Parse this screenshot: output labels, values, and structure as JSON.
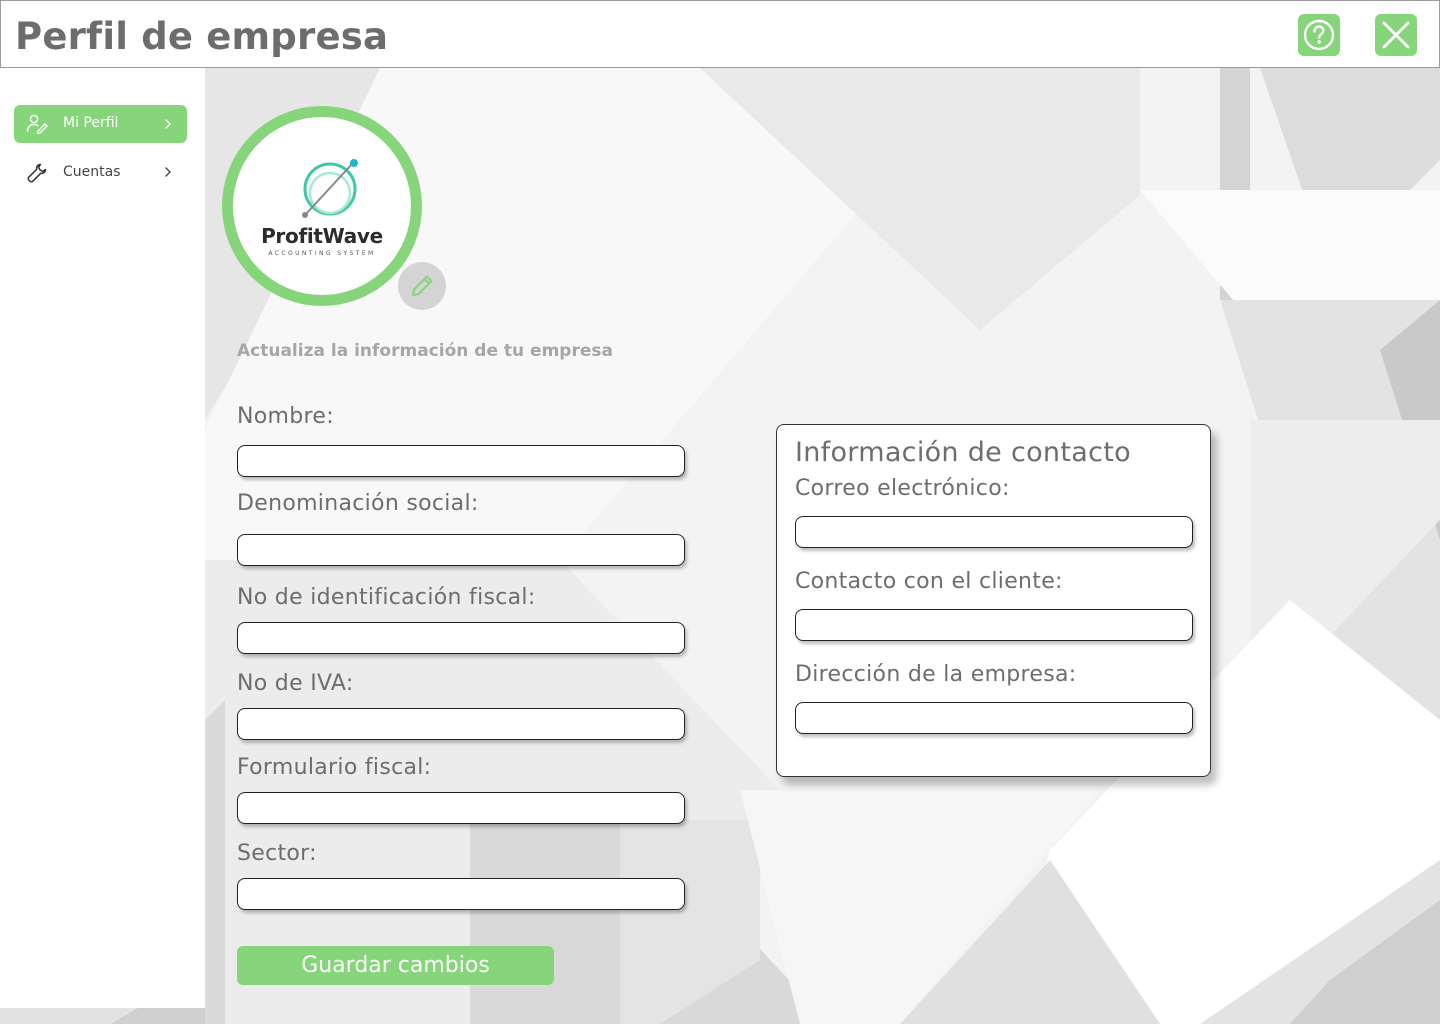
{
  "header": {
    "title": "Perfil de empresa",
    "help_icon": "question-circle-icon",
    "close_icon": "x-icon"
  },
  "sidebar": {
    "items": [
      {
        "label": "Mi Perfil",
        "icon": "user-edit-icon",
        "active": true
      },
      {
        "label": "Cuentas",
        "icon": "wrench-icon",
        "active": false
      }
    ]
  },
  "company_logo": {
    "name": "ProfitWave",
    "tagline": "ACCOUNTING SYSTEM",
    "edit_icon": "pencil-icon"
  },
  "form": {
    "subtitle": "Actualiza la información de tu empresa",
    "fields": [
      {
        "label": "Nombre:",
        "value": ""
      },
      {
        "label": "Denominación social:",
        "value": ""
      },
      {
        "label": "No de identificación fiscal:",
        "value": ""
      },
      {
        "label": "No de IVA:",
        "value": ""
      },
      {
        "label": "Formulario fiscal:",
        "value": ""
      },
      {
        "label": "Sector:",
        "value": ""
      }
    ],
    "save_label": "Guardar cambios"
  },
  "contact": {
    "title": "Información de contacto",
    "fields": [
      {
        "label": "Correo electrónico:",
        "value": ""
      },
      {
        "label": "Contacto con el cliente:",
        "value": ""
      },
      {
        "label": "Dirección de la empresa:",
        "value": ""
      }
    ]
  },
  "colors": {
    "accent": "#86d57a",
    "title_text": "#6d6d6d",
    "subtitle_text": "#a6a6a6"
  }
}
